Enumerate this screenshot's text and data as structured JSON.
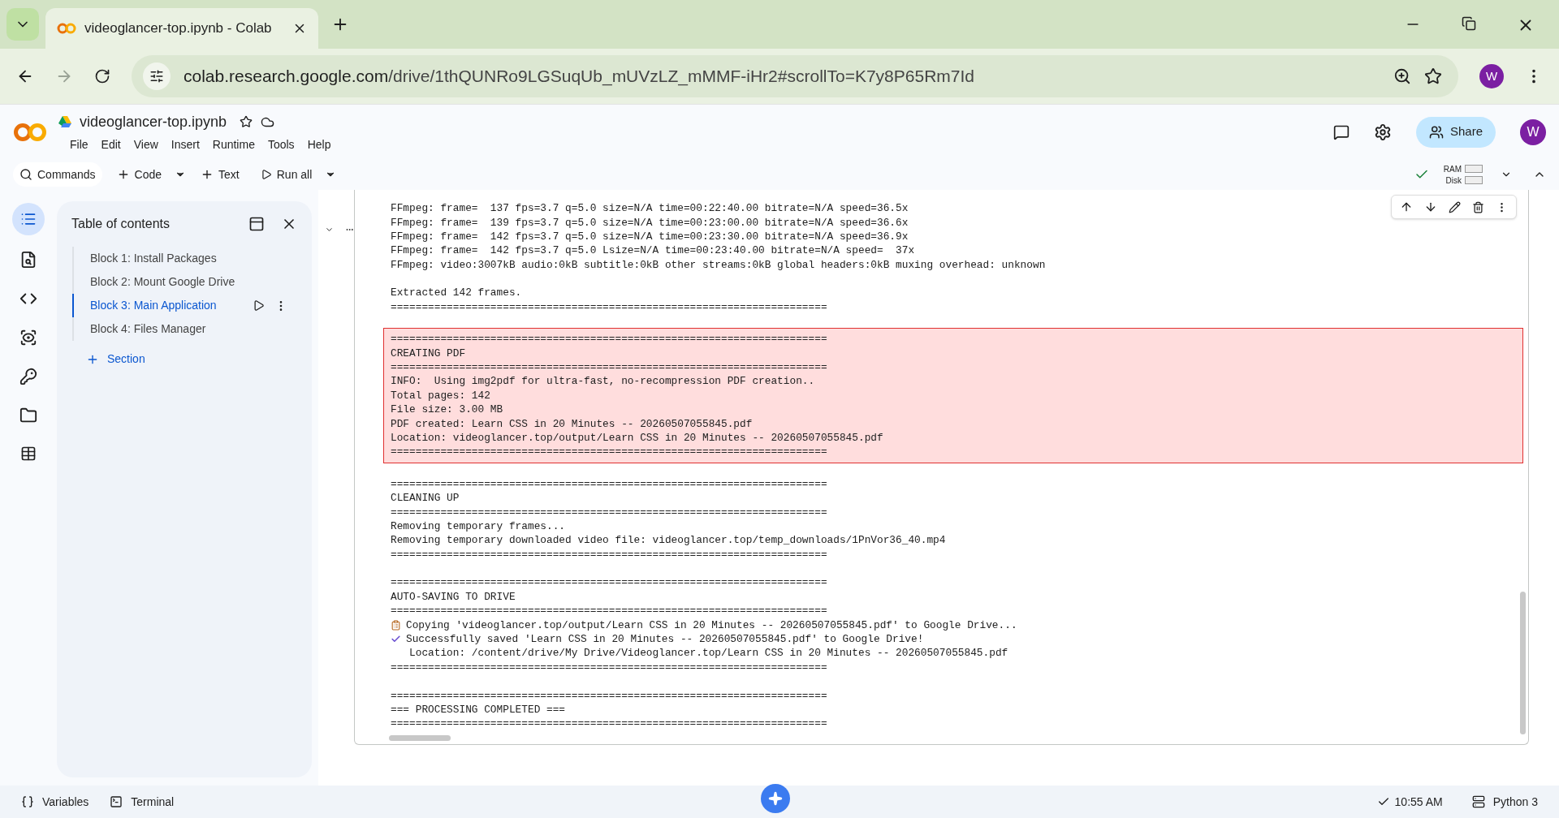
{
  "browser": {
    "tab_title": "videoglancer-top.ipynb - Colab",
    "url_host": "colab.research.google.com",
    "url_path": "/drive/1thQUNRo9LGSuqUb_mUVzLZ_mMMF-iHr2#scrollTo=K7y8P65Rm7Id",
    "avatar": "W"
  },
  "notebook": {
    "title": "videoglancer-top.ipynb",
    "menu": [
      "File",
      "Edit",
      "View",
      "Insert",
      "Runtime",
      "Tools",
      "Help"
    ],
    "share": "Share",
    "avatar": "W"
  },
  "toolbar": {
    "buttons": [
      {
        "kind": "search",
        "label": "Commands",
        "dropdown": false
      },
      {
        "kind": "add",
        "label": "Code",
        "dropdown": true
      },
      {
        "kind": "add",
        "label": "Text",
        "dropdown": false
      },
      {
        "kind": "run",
        "label": "Run all",
        "dropdown": true
      }
    ],
    "resources": [
      "RAM",
      "Disk"
    ]
  },
  "toc": {
    "title": "Table of contents",
    "items": [
      {
        "label": "Block 1: Install Packages",
        "selected": false
      },
      {
        "label": "Block 2: Mount Google Drive",
        "selected": false
      },
      {
        "label": "Block 3: Main Application",
        "selected": true
      },
      {
        "label": "Block 4: Files Manager",
        "selected": false
      }
    ],
    "add_section": "Section"
  },
  "output": {
    "blocks": [
      {
        "highlighted": false,
        "lines": [
          {
            "kind": "text",
            "text": "FFmpeg: frame=  137 fps=3.7 q=5.0 size=N/A time=00:22:40.00 bitrate=N/A speed=36.5x"
          },
          {
            "kind": "text",
            "text": "FFmpeg: frame=  139 fps=3.7 q=5.0 size=N/A time=00:23:00.00 bitrate=N/A speed=36.6x"
          },
          {
            "kind": "text",
            "text": "FFmpeg: frame=  142 fps=3.7 q=5.0 size=N/A time=00:23:30.00 bitrate=N/A speed=36.9x"
          },
          {
            "kind": "text",
            "text": "FFmpeg: frame=  142 fps=3.7 q=5.0 Lsize=N/A time=00:23:40.00 bitrate=N/A speed=  37x"
          },
          {
            "kind": "text",
            "text": "FFmpeg: video:3007kB audio:0kB subtitle:0kB other streams:0kB global headers:0kB muxing overhead: unknown"
          },
          {
            "kind": "blank"
          },
          {
            "kind": "text",
            "text": "Extracted 142 frames."
          },
          {
            "kind": "text",
            "text": "======================================================================"
          }
        ]
      },
      {
        "highlighted": true,
        "lines": [
          {
            "kind": "text",
            "text": "======================================================================"
          },
          {
            "kind": "text",
            "text": "CREATING PDF"
          },
          {
            "kind": "text",
            "text": "======================================================================"
          },
          {
            "kind": "text",
            "text": "INFO:  Using img2pdf for ultra-fast, no-recompression PDF creation.."
          },
          {
            "kind": "text",
            "text": "Total pages: 142"
          },
          {
            "kind": "text",
            "text": "File size: 3.00 MB"
          },
          {
            "kind": "text",
            "text": "PDF created: Learn CSS in 20 Minutes -- 20260507055845.pdf"
          },
          {
            "kind": "text",
            "text": "Location: videoglancer.top/output/Learn CSS in 20 Minutes -- 20260507055845.pdf"
          },
          {
            "kind": "text",
            "text": "======================================================================"
          }
        ]
      },
      {
        "highlighted": false,
        "lines": [
          {
            "kind": "text",
            "text": "======================================================================"
          },
          {
            "kind": "text",
            "text": "CLEANING UP"
          },
          {
            "kind": "text",
            "text": "======================================================================"
          },
          {
            "kind": "text",
            "text": "Removing temporary frames..."
          },
          {
            "kind": "text",
            "text": "Removing temporary downloaded video file: videoglancer.top/temp_downloads/1PnVor36_40.mp4"
          },
          {
            "kind": "text",
            "text": "======================================================================"
          },
          {
            "kind": "blank"
          },
          {
            "kind": "text",
            "text": "======================================================================"
          },
          {
            "kind": "text",
            "text": "AUTO-SAVING TO DRIVE"
          },
          {
            "kind": "text",
            "text": "======================================================================"
          },
          {
            "kind": "clipboard",
            "text": "Copying 'videoglancer.top/output/Learn CSS in 20 Minutes -- 20260507055845.pdf' to Google Drive..."
          },
          {
            "kind": "check",
            "text": "Successfully saved 'Learn CSS in 20 Minutes -- 20260507055845.pdf' to Google Drive!"
          },
          {
            "kind": "text",
            "text": "   Location: /content/drive/My Drive/Videoglancer.top/Learn CSS in 20 Minutes -- 20260507055845.pdf"
          },
          {
            "kind": "text",
            "text": "======================================================================"
          },
          {
            "kind": "blank"
          },
          {
            "kind": "text",
            "text": "======================================================================"
          },
          {
            "kind": "text",
            "text": "=== PROCESSING COMPLETED ==="
          },
          {
            "kind": "text",
            "text": "======================================================================"
          }
        ]
      }
    ]
  },
  "status_bar": {
    "variables": "Variables",
    "terminal": "Terminal",
    "time": "10:55 AM",
    "runtime": "Python 3"
  }
}
